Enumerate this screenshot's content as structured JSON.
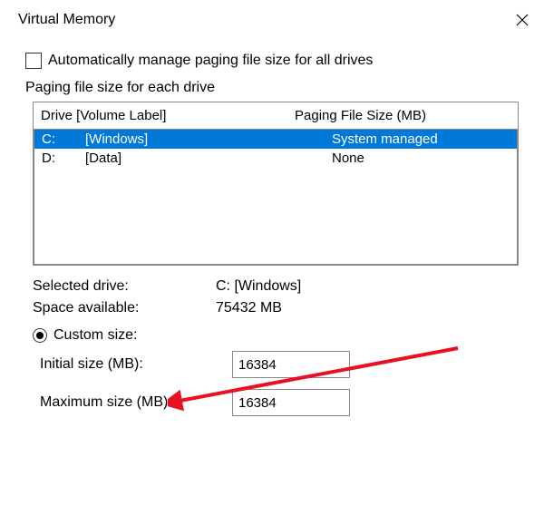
{
  "title": "Virtual Memory",
  "auto_manage_label": "Automatically manage paging file size for all drives",
  "auto_manage_checked": false,
  "section_label": "Paging file size for each drive",
  "drive_header_left": "Drive  [Volume Label]",
  "drive_header_right": "Paging File Size (MB)",
  "drives": [
    {
      "letter": "C:",
      "label": "[Windows]",
      "size": "System managed",
      "selected": true
    },
    {
      "letter": "D:",
      "label": "[Data]",
      "size": "None",
      "selected": false
    }
  ],
  "selected_drive_label": "Selected drive:",
  "selected_drive_value": "C:  [Windows]",
  "space_available_label": "Space available:",
  "space_available_value": "75432 MB",
  "custom_size_label": "Custom size:",
  "custom_size_checked": true,
  "initial_size_label": "Initial size (MB):",
  "initial_size_value": "16384",
  "maximum_size_label": "Maximum size (MB):",
  "maximum_size_value": "16384"
}
